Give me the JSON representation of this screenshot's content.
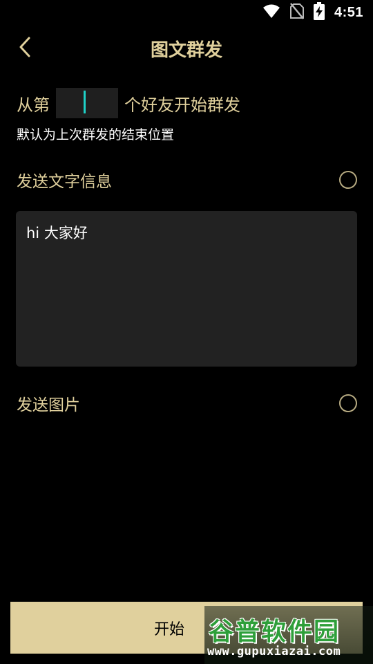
{
  "status_bar": {
    "time": "4:51",
    "icons": [
      "wifi-icon",
      "no-sim-icon",
      "battery-charging-icon"
    ]
  },
  "app_bar": {
    "title": "图文群发",
    "back_icon": "chevron-left-icon"
  },
  "start_position": {
    "prefix": "从第",
    "value": "",
    "suffix": "个好友开始群发",
    "hint": "默认为上次群发的结束位置"
  },
  "text_option": {
    "label": "发送文字信息",
    "checked": false
  },
  "message": {
    "value": "hi 大家好"
  },
  "image_option": {
    "label": "发送图片",
    "checked": false
  },
  "start_button": {
    "label": "开始"
  },
  "watermark": {
    "brand": "谷普软件园",
    "url": "www.gupuxiazai.com"
  },
  "colors": {
    "accent": "#e0d09c",
    "button_bg": "#e0d09d",
    "cursor": "#1fd1c7",
    "input_bg": "#1f1f1f",
    "textarea_bg": "#222222"
  }
}
